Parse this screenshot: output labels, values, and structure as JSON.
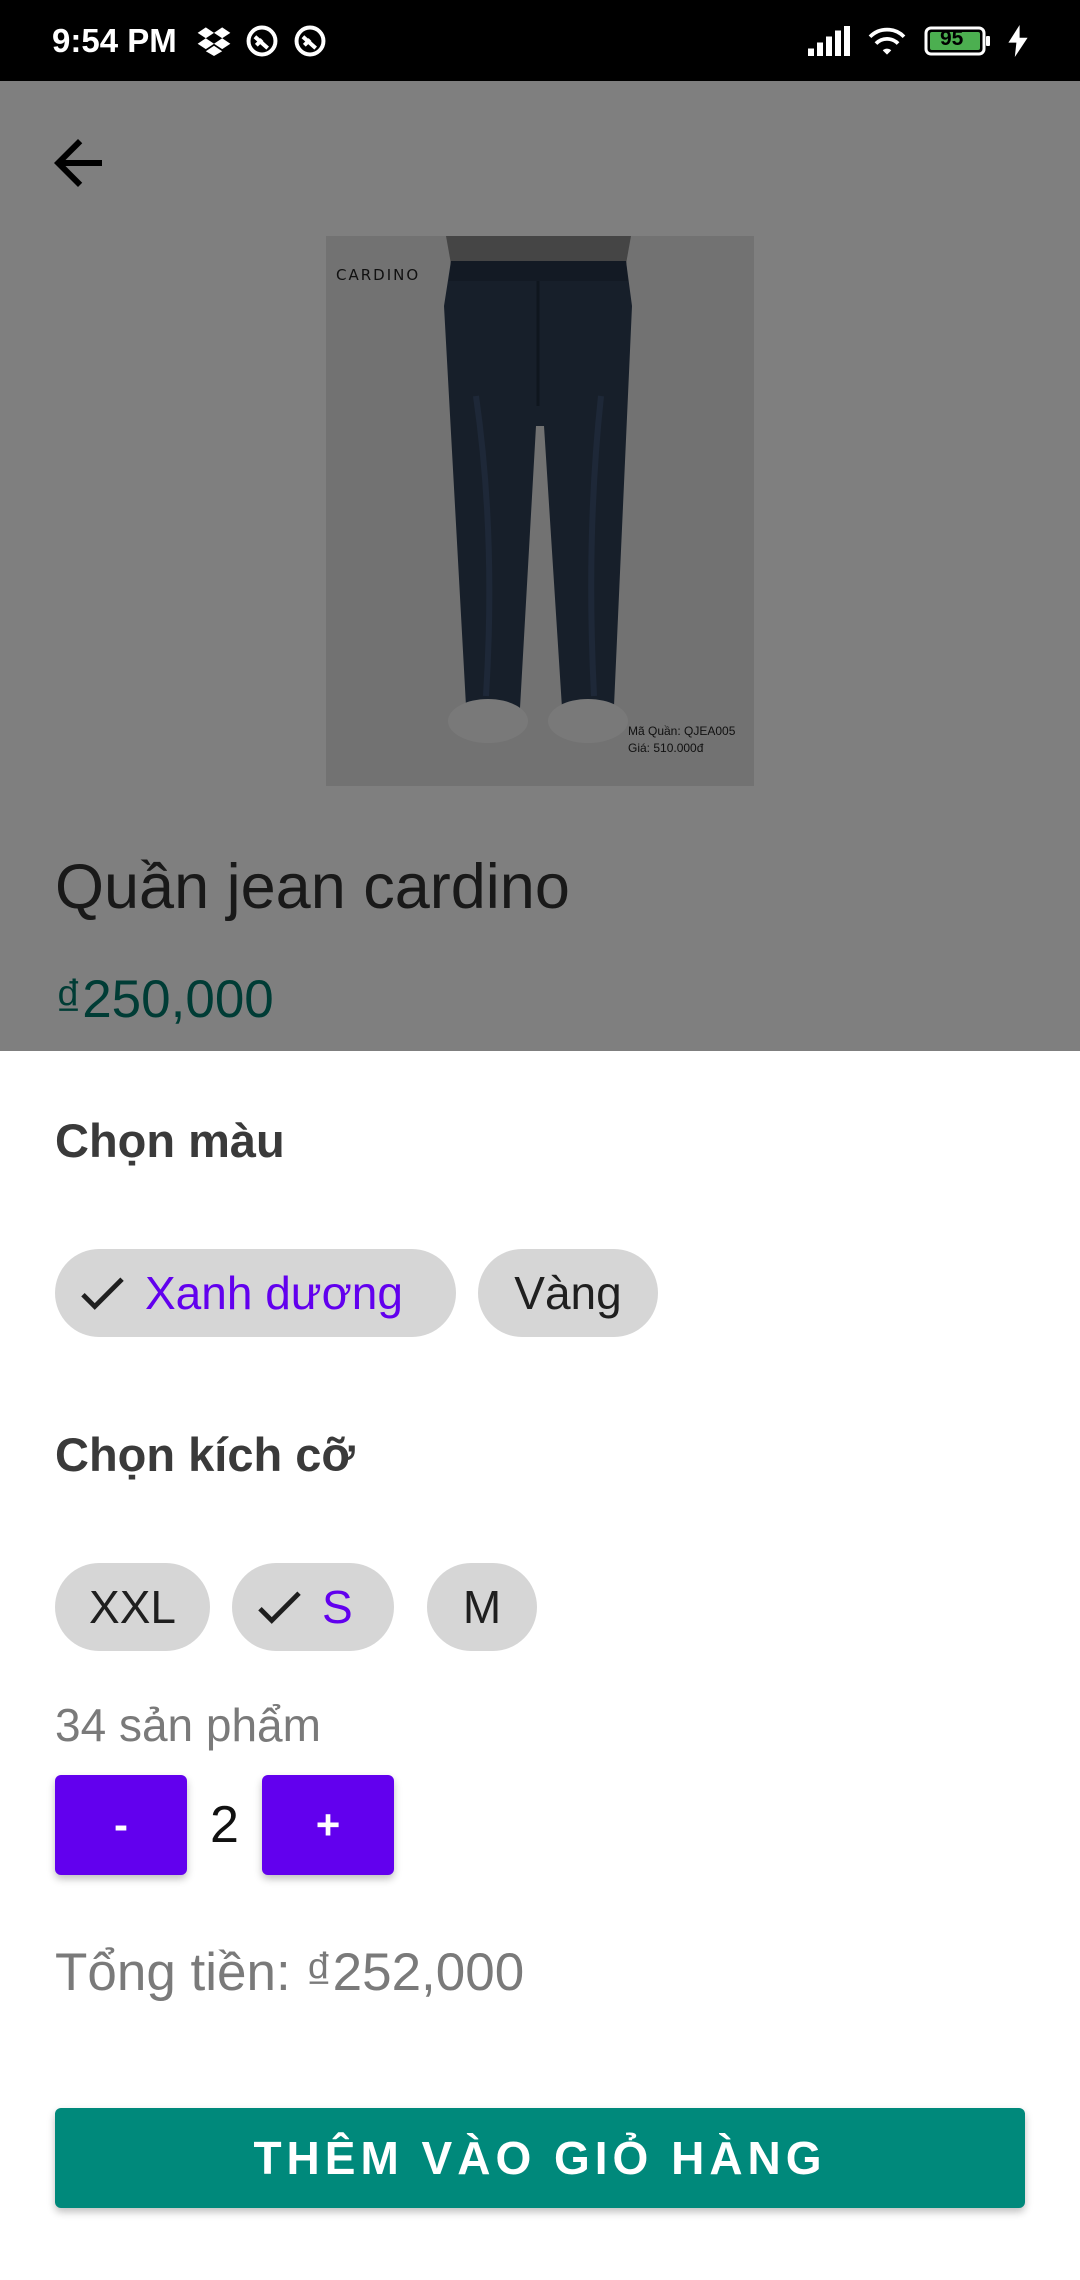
{
  "status_bar": {
    "time": "9:54 PM",
    "battery": "95",
    "icons": [
      "dropbox-icon",
      "sync-icon",
      "sync-icon",
      "signal-icon",
      "wifi-icon",
      "battery-icon",
      "charging-icon"
    ]
  },
  "product": {
    "title": "Quần jean cardino",
    "price": "₫250,000",
    "image": {
      "brand": "CARDINO",
      "caption_code": "Mã Quần: QJEA005",
      "caption_price": "Giá: 510.000đ"
    }
  },
  "sheet": {
    "color_title": "Chọn màu",
    "colors": [
      {
        "label": "Xanh dương",
        "selected": true
      },
      {
        "label": "Vàng",
        "selected": false
      }
    ],
    "size_title": "Chọn kích cỡ",
    "sizes": [
      {
        "label": "XXL",
        "selected": false
      },
      {
        "label": "S",
        "selected": true
      },
      {
        "label": "M",
        "selected": false
      }
    ],
    "stock": "34 sản phẩm",
    "quantity": {
      "minus_label": "-",
      "value": "2",
      "plus_label": "+"
    },
    "total": "Tổng tiền: ₫252,000",
    "add_to_cart_label": "THÊM VÀO GIỎ HÀNG"
  },
  "colors": {
    "accent_purple": "#6200ee",
    "teal": "#00897b",
    "chip_bg": "#d6d6d6"
  }
}
